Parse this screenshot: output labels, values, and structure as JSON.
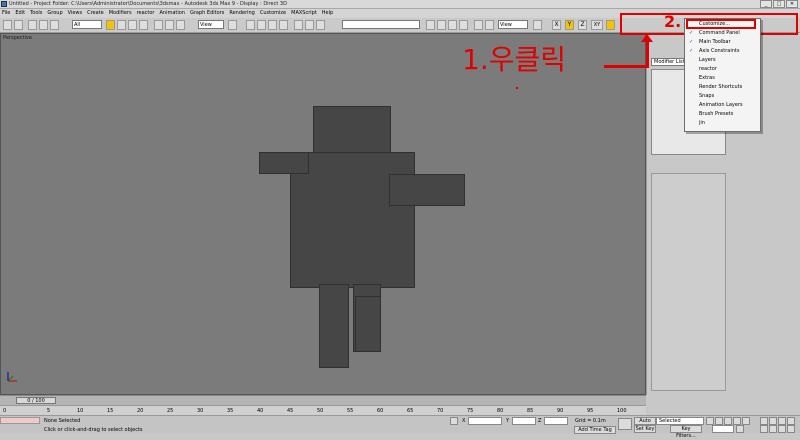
{
  "window": {
    "title": "Untitled   - Project Folder: C:\\Users\\Administrator\\Documents\\3dsmax   - Autodesk 3ds Max 9   - Display : Direct 3D",
    "buttons": [
      "_",
      "□",
      "✕"
    ]
  },
  "menubar": [
    "File",
    "Edit",
    "Tools",
    "Group",
    "Views",
    "Create",
    "Modifiers",
    "reactor",
    "Animation",
    "Graph Editors",
    "Rendering",
    "Customize",
    "MAXScript",
    "Help"
  ],
  "toolbar": {
    "selection_filter": "All",
    "reference_coord": "View",
    "named_selection": "",
    "view_dropdown": "View",
    "axis_labels": [
      "X",
      "Y",
      "Z",
      "XY"
    ]
  },
  "viewport": {
    "label": "Perspective",
    "background": "#7b7b7b"
  },
  "command_panel": {
    "modifier_list": "Modifier List"
  },
  "context_menu": {
    "items": [
      {
        "label": "Customize...",
        "checked": false
      },
      {
        "label": "Command Panel",
        "checked": true
      },
      {
        "label": "Main Toolbar",
        "checked": true
      },
      {
        "label": "Axis Constraints",
        "checked": true
      },
      {
        "label": "Layers",
        "checked": false
      },
      {
        "label": "reactor",
        "checked": false
      },
      {
        "label": "Extras",
        "checked": false
      },
      {
        "label": "Render Shortcuts",
        "checked": false
      },
      {
        "label": "Snaps",
        "checked": false
      },
      {
        "label": "Animation Layers",
        "checked": false
      },
      {
        "label": "Brush Presets",
        "checked": false
      },
      {
        "label": "jin",
        "checked": false
      }
    ]
  },
  "annotations": {
    "step1": "1.우클릭",
    "step2": "2.",
    "accent": "#e00000"
  },
  "timeline": {
    "frame": "0 / 100"
  },
  "ruler": [
    "0",
    "5",
    "10",
    "15",
    "20",
    "25",
    "30",
    "35",
    "40",
    "45",
    "50",
    "55",
    "60",
    "65",
    "70",
    "75",
    "80",
    "85",
    "90",
    "95",
    "100"
  ],
  "status": {
    "selection": "None Selected",
    "prompt": "Click or click-and-drag to select objects",
    "x_label": "X",
    "y_label": "Y",
    "z_label": "Z",
    "grid": "Grid = 0.1m",
    "auto_key": "Auto Key",
    "set_key": "Set Key",
    "selected": "Selected",
    "key_filters": "Key Filters...",
    "add_time_tag": "Add Time Tag"
  }
}
